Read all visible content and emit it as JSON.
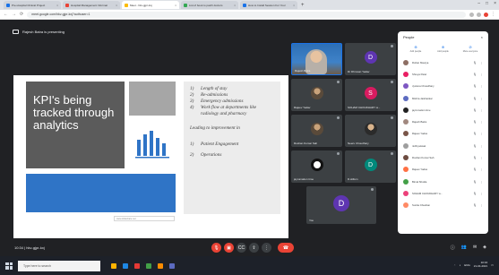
{
  "browser": {
    "tabs": [
      {
        "label": "Pre-Hospital Clinical Project"
      },
      {
        "label": "Hospital Management Informat"
      },
      {
        "label": "Meet - hkv-gjpr-kxj",
        "active": true
      },
      {
        "label": "List of book to patch doctors"
      },
      {
        "label": "How to Install Session For Your"
      }
    ],
    "url": "meet.google.com/hkv-gjpr-kxj?authuser=1"
  },
  "meet": {
    "presenting_banner": "Rajesh Batra is presenting",
    "clock": "10:34",
    "meeting_code": "hkv-gjpr-kxj",
    "slide": {
      "title": "KPI's being tracked through analytics",
      "list_top": [
        {
          "n": "1)",
          "text": "Length of stay"
        },
        {
          "n": "2)",
          "text": "Re-admissions"
        },
        {
          "n": "3)",
          "text": "Emergency admissions"
        },
        {
          "n": "4)",
          "text": "Work flow at departments like radiology and pharmacy"
        }
      ],
      "lead": "Leading to improvement in",
      "list_bottom": [
        {
          "n": "1)",
          "text": "Patient Engagement"
        },
        {
          "n": "2)",
          "text": "Operations"
        }
      ],
      "caption": "www.slideshare.net"
    },
    "tiles": [
      {
        "name": "Rajesh Batra",
        "type": "live"
      },
      {
        "name": "Dr Dhruvan Yadav",
        "type": "letter",
        "letter": "D",
        "color": "#5e35b1"
      },
      {
        "name": "Rajeev Yadav",
        "type": "photo"
      },
      {
        "name": "SOHAM CHOUDHARY w...",
        "type": "letter",
        "letter": "S",
        "color": "#d81b60"
      },
      {
        "name": "Roshan Kumar Sah",
        "type": "photo"
      },
      {
        "name": "Neeru Choudhary",
        "type": "photo"
      },
      {
        "name": "jayrumation time",
        "type": "photo2"
      },
      {
        "name": "D.stillum",
        "type": "letter",
        "letter": "D",
        "color": "#00897b"
      },
      {
        "name": "You",
        "type": "letter",
        "letter": "D",
        "color": "#5e35b1"
      }
    ],
    "controls": {
      "mic": "mic-off",
      "cam": "cam-off",
      "cc": "CC",
      "present": "present",
      "more": "⋮",
      "end": "end call"
    }
  },
  "people": {
    "title": "People",
    "actions": [
      {
        "label": "Add people",
        "icon": "person-add"
      },
      {
        "label": "Add people",
        "icon": "person-add-2"
      },
      {
        "label": "Mute everyone",
        "icon": "mute"
      }
    ],
    "list": [
      {
        "name": "Rohan Maurya",
        "color": "#8d6e63"
      },
      {
        "name": "Shreya Patel",
        "color": "#e91e63"
      },
      {
        "name": "Jyotsna Chowdhary",
        "color": "#7e57c2"
      },
      {
        "name": "Mishra Jaishankar",
        "color": "#5c6bc0"
      },
      {
        "name": "jayrumation time",
        "color": "#212121"
      },
      {
        "name": "Rajesh Batra",
        "color": "#a1887f"
      },
      {
        "name": "Rajeev Yadav",
        "color": "#795548"
      },
      {
        "name": "nidhi jaiswal",
        "color": "#9e9e9e"
      },
      {
        "name": "Roshan Kumar Sah",
        "color": "#6d4c41"
      },
      {
        "name": "Rajeev Yadav",
        "color": "#ff7043"
      },
      {
        "name": "Bimal Shukla",
        "color": "#43a047"
      },
      {
        "name": "SOHAM CHOUDHARY w...",
        "color": "#ec407a"
      },
      {
        "name": "Sunita Chauhan",
        "color": "#ff8a65"
      }
    ]
  },
  "taskbar": {
    "search_placeholder": "Type here to search",
    "time": "10:34",
    "date": "21-04-2021",
    "lang": "ENG"
  },
  "colors": {
    "meet_bg": "#202124",
    "tile_bg": "#3c4043",
    "danger": "#ea4335",
    "accent": "#1a73e8",
    "slide_blue": "#2f74c6"
  }
}
